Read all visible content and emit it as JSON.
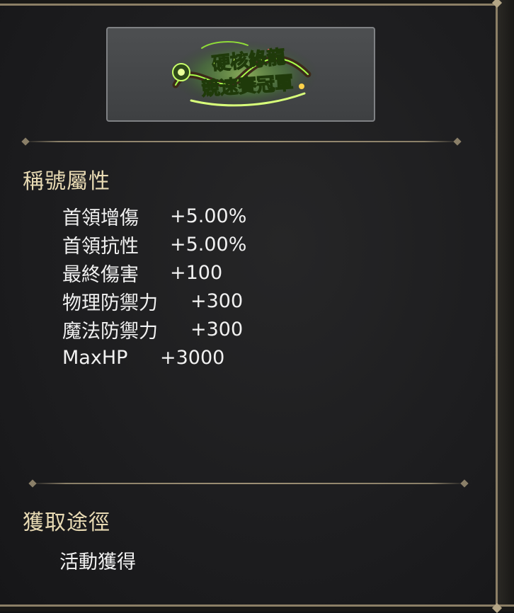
{
  "title_banner": {
    "line1": "硬核綠龍",
    "line2": "競速賽冠軍",
    "colors": {
      "glow": "#9cff3a",
      "text": "#d9ff8a",
      "accent": "#ffd34a"
    }
  },
  "attributes": {
    "heading": "稱號屬性",
    "stats": [
      {
        "name": "首領增傷",
        "value": "+5.00%"
      },
      {
        "name": "首領抗性",
        "value": "+5.00%"
      },
      {
        "name": "最終傷害",
        "value": "+100"
      },
      {
        "name": "物理防禦力",
        "value": "+300"
      },
      {
        "name": "魔法防禦力",
        "value": "+300"
      },
      {
        "name": "MaxHP",
        "value": "+3000"
      }
    ]
  },
  "acquisition": {
    "heading": "獲取途徑",
    "method": "活動獲得"
  },
  "theme": {
    "heading_color": "#e9dbb4",
    "text_color": "#f1f1f1",
    "frame_color": "#8c7f66"
  }
}
